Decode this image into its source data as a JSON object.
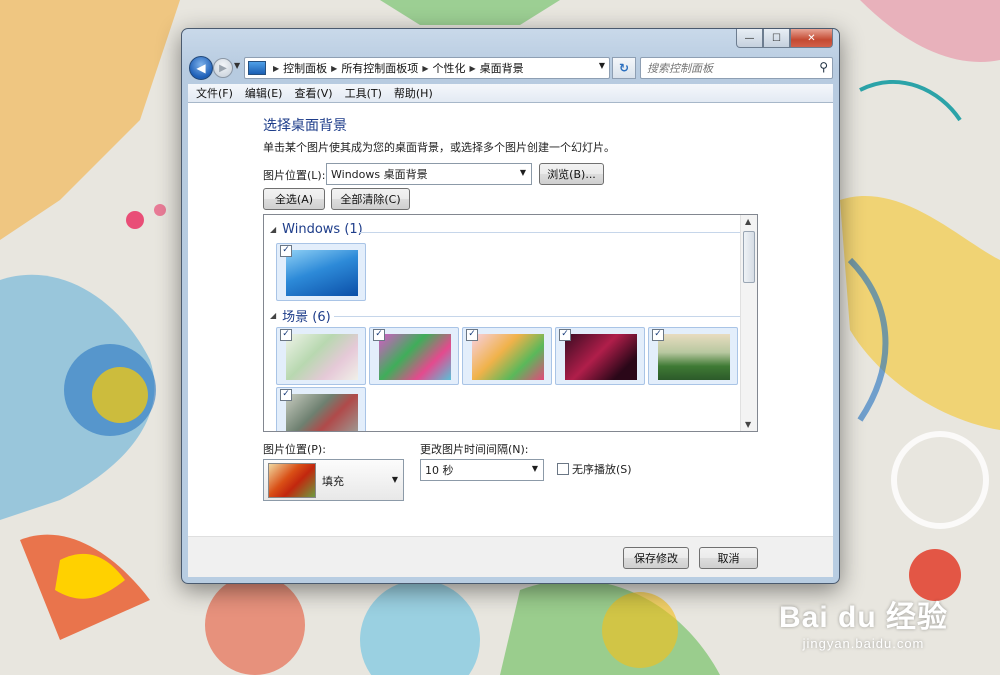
{
  "colors": {
    "accent_title": "#1e3d8a",
    "titlebar": "#b8cde2",
    "close_button": "#c44a32",
    "selection": "#e3eefb"
  },
  "window": {
    "caption_buttons": {
      "minimize_icon": "minimize-icon",
      "maximize_icon": "maximize-icon",
      "close_icon": "close-icon"
    }
  },
  "address": {
    "crumbs": [
      "控制面板",
      "所有控制面板项",
      "个性化",
      "桌面背景"
    ]
  },
  "search": {
    "placeholder": "搜索控制面板"
  },
  "menu": [
    "文件(F)",
    "编辑(E)",
    "查看(V)",
    "工具(T)",
    "帮助(H)"
  ],
  "main": {
    "title": "选择桌面背景",
    "description": "单击某个图片使其成为您的桌面背景，或选择多个图片创建一个幻灯片。",
    "location_label": "图片位置(L):",
    "location_value": "Windows 桌面背景",
    "browse_button": "浏览(B)...",
    "select_all_button": "全选(A)",
    "clear_all_button": "全部清除(C)"
  },
  "gallery": {
    "groups": [
      {
        "name": "Windows (1)",
        "count": 1
      },
      {
        "name": "场景 (6)",
        "count": 6
      }
    ],
    "checked_mark": "✓"
  },
  "options": {
    "position_label": "图片位置(P):",
    "position_value": "填充",
    "interval_label": "更改图片时间间隔(N):",
    "interval_value": "10 秒",
    "shuffle_label": "无序播放(S)",
    "shuffle_checked": false
  },
  "footer": {
    "save_button": "保存修改",
    "cancel_button": "取消"
  },
  "watermark": {
    "main": "Bai du 经验",
    "sub": "jingyan.baidu.com"
  }
}
